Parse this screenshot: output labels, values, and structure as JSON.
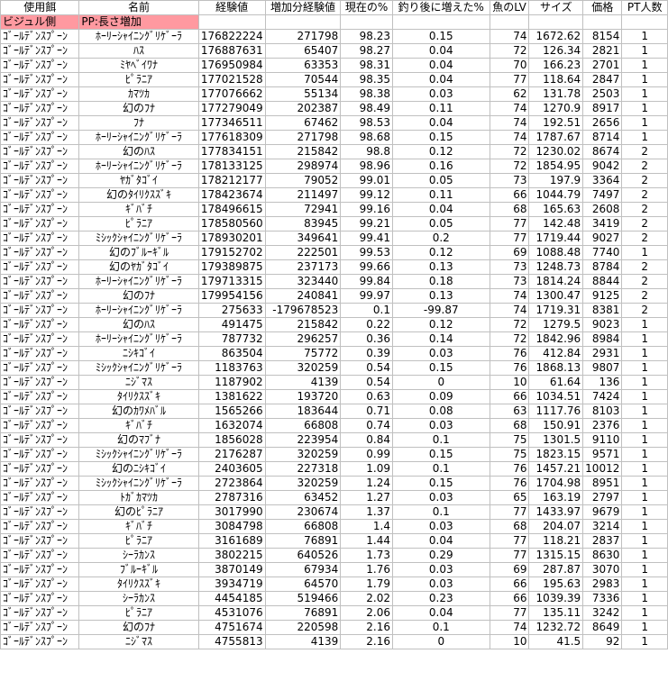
{
  "columns": [
    "使用餌",
    "名前",
    "経験値",
    "増加分経験値",
    "現在の%",
    "釣り後に増えた%",
    "魚のLV",
    "サイズ",
    "価格",
    "PT人数"
  ],
  "subheader": {
    "bait_side": "ビジュル側",
    "pp_note": "PP:長さ増加"
  },
  "rows": [
    [
      "ｺﾞｰﾙﾃﾞﾝｽﾌﾟｰﾝ",
      "ﾎｰﾘｰｼｬｲﾆﾝｸﾞﾘｹﾞｰﾗ",
      "176822224",
      "271798",
      "98.23",
      "0.15",
      "74",
      "1672.62",
      "8154",
      "1"
    ],
    [
      "ｺﾞｰﾙﾃﾞﾝｽﾌﾟｰﾝ",
      "ﾊｽ",
      "176887631",
      "65407",
      "98.27",
      "0.04",
      "72",
      "126.34",
      "2821",
      "1"
    ],
    [
      "ｺﾞｰﾙﾃﾞﾝｽﾌﾟｰﾝ",
      "ﾐﾔﾍﾞｲﾜﾅ",
      "176950984",
      "63353",
      "98.31",
      "0.04",
      "70",
      "166.23",
      "2701",
      "1"
    ],
    [
      "ｺﾞｰﾙﾃﾞﾝｽﾌﾟｰﾝ",
      "ﾋﾟﾗﾆｱ",
      "177021528",
      "70544",
      "98.35",
      "0.04",
      "77",
      "118.64",
      "2847",
      "1"
    ],
    [
      "ｺﾞｰﾙﾃﾞﾝｽﾌﾟｰﾝ",
      "ｶﾏﾂｶ",
      "177076662",
      "55134",
      "98.38",
      "0.03",
      "62",
      "131.78",
      "2503",
      "1"
    ],
    [
      "ｺﾞｰﾙﾃﾞﾝｽﾌﾟｰﾝ",
      "幻のﾌﾅ",
      "177279049",
      "202387",
      "98.49",
      "0.11",
      "74",
      "1270.9",
      "8917",
      "1"
    ],
    [
      "ｺﾞｰﾙﾃﾞﾝｽﾌﾟｰﾝ",
      "ﾌﾅ",
      "177346511",
      "67462",
      "98.53",
      "0.04",
      "74",
      "192.51",
      "2656",
      "1"
    ],
    [
      "ｺﾞｰﾙﾃﾞﾝｽﾌﾟｰﾝ",
      "ﾎｰﾘｰｼｬｲﾆﾝｸﾞﾘｹﾞｰﾗ",
      "177618309",
      "271798",
      "98.68",
      "0.15",
      "74",
      "1787.67",
      "8714",
      "1"
    ],
    [
      "ｺﾞｰﾙﾃﾞﾝｽﾌﾟｰﾝ",
      "幻のﾊｽ",
      "177834151",
      "215842",
      "98.8",
      "0.12",
      "72",
      "1230.02",
      "8674",
      "2"
    ],
    [
      "ｺﾞｰﾙﾃﾞﾝｽﾌﾟｰﾝ",
      "ﾎｰﾘｰｼｬｲﾆﾝｸﾞﾘｹﾞｰﾗ",
      "178133125",
      "298974",
      "98.96",
      "0.16",
      "72",
      "1854.95",
      "9042",
      "2"
    ],
    [
      "ｺﾞｰﾙﾃﾞﾝｽﾌﾟｰﾝ",
      "ﾔｶﾞﾀｺﾞｲ",
      "178212177",
      "79052",
      "99.01",
      "0.05",
      "73",
      "197.9",
      "3364",
      "2"
    ],
    [
      "ｺﾞｰﾙﾃﾞﾝｽﾌﾟｰﾝ",
      "幻のﾀｲﾘｸｽｽﾞｷ",
      "178423674",
      "211497",
      "99.12",
      "0.11",
      "66",
      "1044.79",
      "7497",
      "2"
    ],
    [
      "ｺﾞｰﾙﾃﾞﾝｽﾌﾟｰﾝ",
      "ｷﾞﾊﾞﾁ",
      "178496615",
      "72941",
      "99.16",
      "0.04",
      "68",
      "165.63",
      "2608",
      "2"
    ],
    [
      "ｺﾞｰﾙﾃﾞﾝｽﾌﾟｰﾝ",
      "ﾋﾟﾗﾆｱ",
      "178580560",
      "83945",
      "99.21",
      "0.05",
      "77",
      "142.48",
      "3419",
      "2"
    ],
    [
      "ｺﾞｰﾙﾃﾞﾝｽﾌﾟｰﾝ",
      "ﾐｼｯｸｼｬｲﾆﾝｸﾞﾘｹﾞｰﾗ",
      "178930201",
      "349641",
      "99.41",
      "0.2",
      "77",
      "1719.44",
      "9027",
      "2"
    ],
    [
      "ｺﾞｰﾙﾃﾞﾝｽﾌﾟｰﾝ",
      "幻のﾌﾞﾙｰｷﾞﾙ",
      "179152702",
      "222501",
      "99.53",
      "0.12",
      "69",
      "1088.48",
      "7740",
      "1"
    ],
    [
      "ｺﾞｰﾙﾃﾞﾝｽﾌﾟｰﾝ",
      "幻のﾔｶﾞﾀｺﾞｲ",
      "179389875",
      "237173",
      "99.66",
      "0.13",
      "73",
      "1248.73",
      "8784",
      "2"
    ],
    [
      "ｺﾞｰﾙﾃﾞﾝｽﾌﾟｰﾝ",
      "ﾎｰﾘｰｼｬｲﾆﾝｸﾞﾘｹﾞｰﾗ",
      "179713315",
      "323440",
      "99.84",
      "0.18",
      "73",
      "1814.24",
      "8844",
      "2"
    ],
    [
      "ｺﾞｰﾙﾃﾞﾝｽﾌﾟｰﾝ",
      "幻のﾌﾅ",
      "179954156",
      "240841",
      "99.97",
      "0.13",
      "74",
      "1300.47",
      "9125",
      "2"
    ],
    [
      "ｺﾞｰﾙﾃﾞﾝｽﾌﾟｰﾝ",
      "ﾎｰﾘｰｼｬｲﾆﾝｸﾞﾘｹﾞｰﾗ",
      "275633",
      "-179678523",
      "0.1",
      "-99.87",
      "74",
      "1719.31",
      "8381",
      "2"
    ],
    [
      "ｺﾞｰﾙﾃﾞﾝｽﾌﾟｰﾝ",
      "幻のﾊｽ",
      "491475",
      "215842",
      "0.22",
      "0.12",
      "72",
      "1279.5",
      "9023",
      "1"
    ],
    [
      "ｺﾞｰﾙﾃﾞﾝｽﾌﾟｰﾝ",
      "ﾎｰﾘｰｼｬｲﾆﾝｸﾞﾘｹﾞｰﾗ",
      "787732",
      "296257",
      "0.36",
      "0.14",
      "72",
      "1842.96",
      "8984",
      "1"
    ],
    [
      "ｺﾞｰﾙﾃﾞﾝｽﾌﾟｰﾝ",
      "ﾆｼｷｺﾞｲ",
      "863504",
      "75772",
      "0.39",
      "0.03",
      "76",
      "412.84",
      "2931",
      "1"
    ],
    [
      "ｺﾞｰﾙﾃﾞﾝｽﾌﾟｰﾝ",
      "ﾐｼｯｸｼｬｲﾆﾝｸﾞﾘｹﾞｰﾗ",
      "1183763",
      "320259",
      "0.54",
      "0.15",
      "76",
      "1868.13",
      "9807",
      "1"
    ],
    [
      "ｺﾞｰﾙﾃﾞﾝｽﾌﾟｰﾝ",
      "ﾆｼﾞﾏｽ",
      "1187902",
      "4139",
      "0.54",
      "0",
      "10",
      "61.64",
      "136",
      "1"
    ],
    [
      "ｺﾞｰﾙﾃﾞﾝｽﾌﾟｰﾝ",
      "ﾀｲﾘｸｽｽﾞｷ",
      "1381622",
      "193720",
      "0.63",
      "0.09",
      "66",
      "1034.51",
      "7424",
      "1"
    ],
    [
      "ｺﾞｰﾙﾃﾞﾝｽﾌﾟｰﾝ",
      "幻のｶﾜﾒﾊﾞﾙ",
      "1565266",
      "183644",
      "0.71",
      "0.08",
      "63",
      "1117.76",
      "8103",
      "1"
    ],
    [
      "ｺﾞｰﾙﾃﾞﾝｽﾌﾟｰﾝ",
      "ｷﾞﾊﾞﾁ",
      "1632074",
      "66808",
      "0.74",
      "0.03",
      "68",
      "150.91",
      "2376",
      "1"
    ],
    [
      "ｺﾞｰﾙﾃﾞﾝｽﾌﾟｰﾝ",
      "幻のﾏﾌﾞﾅ",
      "1856028",
      "223954",
      "0.84",
      "0.1",
      "75",
      "1301.5",
      "9110",
      "1"
    ],
    [
      "ｺﾞｰﾙﾃﾞﾝｽﾌﾟｰﾝ",
      "ﾐｼｯｸｼｬｲﾆﾝｸﾞﾘｹﾞｰﾗ",
      "2176287",
      "320259",
      "0.99",
      "0.15",
      "75",
      "1823.15",
      "9571",
      "1"
    ],
    [
      "ｺﾞｰﾙﾃﾞﾝｽﾌﾟｰﾝ",
      "幻のﾆｼｷｺﾞｲ",
      "2403605",
      "227318",
      "1.09",
      "0.1",
      "76",
      "1457.21",
      "10012",
      "1"
    ],
    [
      "ｺﾞｰﾙﾃﾞﾝｽﾌﾟｰﾝ",
      "ﾐｼｯｸｼｬｲﾆﾝｸﾞﾘｹﾞｰﾗ",
      "2723864",
      "320259",
      "1.24",
      "0.15",
      "76",
      "1704.98",
      "8951",
      "1"
    ],
    [
      "ｺﾞｰﾙﾃﾞﾝｽﾌﾟｰﾝ",
      "ﾄｶﾞｶﾏﾂｶ",
      "2787316",
      "63452",
      "1.27",
      "0.03",
      "65",
      "163.19",
      "2797",
      "1"
    ],
    [
      "ｺﾞｰﾙﾃﾞﾝｽﾌﾟｰﾝ",
      "幻のﾋﾟﾗﾆｱ",
      "3017990",
      "230674",
      "1.37",
      "0.1",
      "77",
      "1433.97",
      "9679",
      "1"
    ],
    [
      "ｺﾞｰﾙﾃﾞﾝｽﾌﾟｰﾝ",
      "ｷﾞﾊﾞﾁ",
      "3084798",
      "66808",
      "1.4",
      "0.03",
      "68",
      "204.07",
      "3214",
      "1"
    ],
    [
      "ｺﾞｰﾙﾃﾞﾝｽﾌﾟｰﾝ",
      "ﾋﾟﾗﾆｱ",
      "3161689",
      "76891",
      "1.44",
      "0.04",
      "77",
      "118.21",
      "2837",
      "1"
    ],
    [
      "ｺﾞｰﾙﾃﾞﾝｽﾌﾟｰﾝ",
      "ｼｰﾗｶﾝｽ",
      "3802215",
      "640526",
      "1.73",
      "0.29",
      "77",
      "1315.15",
      "8630",
      "1"
    ],
    [
      "ｺﾞｰﾙﾃﾞﾝｽﾌﾟｰﾝ",
      "ﾌﾞﾙｰｷﾞﾙ",
      "3870149",
      "67934",
      "1.76",
      "0.03",
      "69",
      "287.87",
      "3070",
      "1"
    ],
    [
      "ｺﾞｰﾙﾃﾞﾝｽﾌﾟｰﾝ",
      "ﾀｲﾘｸｽｽﾞｷ",
      "3934719",
      "64570",
      "1.79",
      "0.03",
      "66",
      "195.63",
      "2983",
      "1"
    ],
    [
      "ｺﾞｰﾙﾃﾞﾝｽﾌﾟｰﾝ",
      "ｼｰﾗｶﾝｽ",
      "4454185",
      "519466",
      "2.02",
      "0.23",
      "66",
      "1039.39",
      "7336",
      "1"
    ],
    [
      "ｺﾞｰﾙﾃﾞﾝｽﾌﾟｰﾝ",
      "ﾋﾟﾗﾆｱ",
      "4531076",
      "76891",
      "2.06",
      "0.04",
      "77",
      "135.11",
      "3242",
      "1"
    ],
    [
      "ｺﾞｰﾙﾃﾞﾝｽﾌﾟｰﾝ",
      "幻のﾌﾅ",
      "4751674",
      "220598",
      "2.16",
      "0.1",
      "74",
      "1232.72",
      "8649",
      "1"
    ],
    [
      "ｺﾞｰﾙﾃﾞﾝｽﾌﾟｰﾝ",
      "ﾆｼﾞﾏｽ",
      "4755813",
      "4139",
      "2.16",
      "0",
      "10",
      "41.5",
      "92",
      "1"
    ]
  ],
  "colors": {
    "subheader_fill": "#ff99a0",
    "gridline": "#c0c0c0"
  }
}
